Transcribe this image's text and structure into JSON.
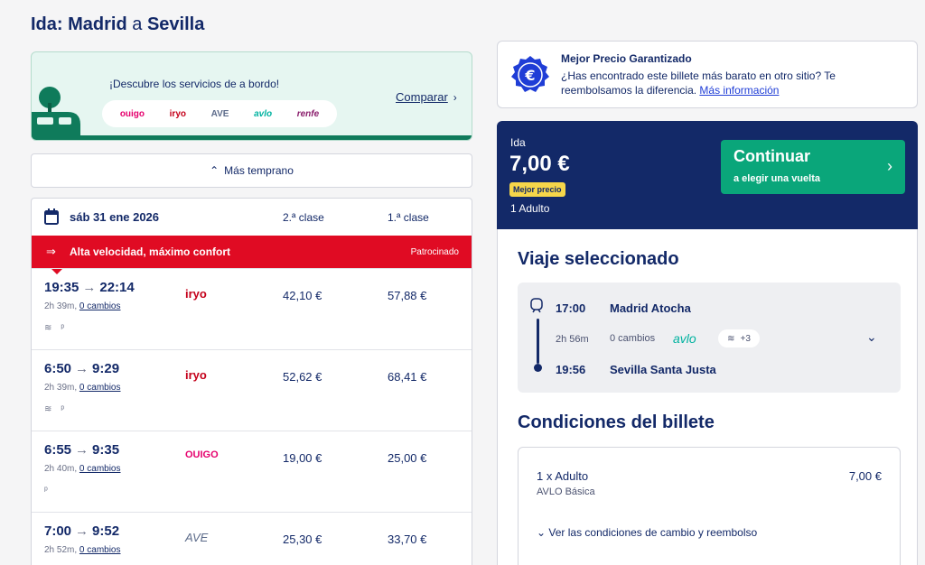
{
  "header": {
    "prefix": "Ida:",
    "origin": "Madrid",
    "connector": "a",
    "destination": "Sevilla"
  },
  "banner": {
    "text": "¡Descubre los servicios de a bordo!",
    "brands": [
      {
        "name": "ouigo",
        "color": "#e5006d"
      },
      {
        "name": "iryo",
        "color": "#c4001a"
      },
      {
        "name": "AVE",
        "color": "#5c6b8a"
      },
      {
        "name": "avlo",
        "color": "#00b2a0"
      },
      {
        "name": "renfe",
        "color": "#8a1e6c"
      }
    ],
    "compare_label": "Comparar"
  },
  "earlier_label": "Más temprano",
  "results": {
    "date": "sáb 31 ene 2026",
    "class2": "2.ª clase",
    "class1": "1.ª clase",
    "promo": {
      "text": "Alta velocidad, máximo confort",
      "sponsored": "Patrocinado"
    },
    "rows": [
      {
        "dep": "19:35",
        "arr": "22:14",
        "duration": "2h 39m,",
        "changes": "0 cambios",
        "operator": "iryo",
        "op_color": "#c4001a",
        "price2": "42,10 €",
        "price1": "57,88 €",
        "wifi": true
      },
      {
        "dep": "6:50",
        "arr": "9:29",
        "duration": "2h 39m,",
        "changes": "0 cambios",
        "operator": "iryo",
        "op_color": "#c4001a",
        "price2": "52,62 €",
        "price1": "68,41 €",
        "wifi": true
      },
      {
        "dep": "6:55",
        "arr": "9:35",
        "duration": "2h 40m,",
        "changes": "0 cambios",
        "operator": "OUIGO",
        "op_color": "#e5006d",
        "price2": "19,00 €",
        "price1": "25,00 €",
        "wifi": false
      },
      {
        "dep": "7:00",
        "arr": "9:52",
        "duration": "2h 52m,",
        "changes": "0 cambios",
        "operator": "AVE",
        "op_color": "#5c6b8a",
        "price2": "25,30 €",
        "price1": "33,70 €",
        "wifi": false
      }
    ]
  },
  "guarantee": {
    "title": "Mejor Precio Garantizado",
    "text": "¿Has encontrado este billete más barato en otro sitio? Te reembolsamos la diferencia.",
    "link": "Más información"
  },
  "summary": {
    "label": "Ida",
    "price": "7,00 €",
    "badge": "Mejor precio",
    "passengers": "1 Adulto",
    "continue_label": "Continuar",
    "continue_sub": "a elegir una vuelta"
  },
  "trip": {
    "heading": "Viaje seleccionado",
    "dep_time": "17:00",
    "dep_station": "Madrid Atocha",
    "duration": "2h 56m",
    "changes": "0 cambios",
    "brand": "avlo",
    "amenities_extra": "+3",
    "arr_time": "19:56",
    "arr_station": "Sevilla Santa Justa"
  },
  "conditions": {
    "heading": "Condiciones del billete",
    "qty": "1 x Adulto",
    "price": "7,00 €",
    "fare": "AVLO Básica",
    "link": "Ver las condiciones de cambio y reembolso"
  }
}
